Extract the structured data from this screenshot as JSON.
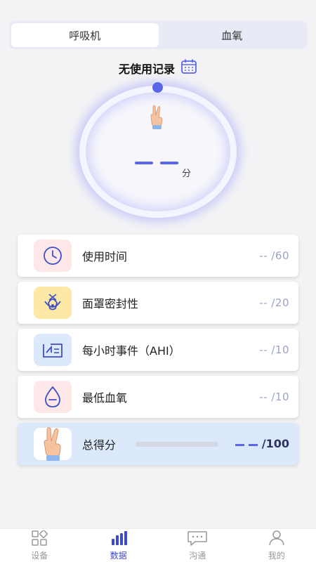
{
  "tabs": [
    {
      "label": "呼吸机",
      "active": true
    },
    {
      "label": "血氧",
      "active": false
    }
  ],
  "status": {
    "text": "无使用记录",
    "icon": "calendar-icon"
  },
  "score": {
    "unit": "分"
  },
  "metrics": [
    {
      "label": "使用时间",
      "value": "-- /60",
      "icon": "clock-icon",
      "icon_bg": "#fde7e8"
    },
    {
      "label": "面罩密封性",
      "value": "-- /20",
      "icon": "mask-icon",
      "icon_bg": "#fde9a6"
    },
    {
      "label": "每小时事件（AHI）",
      "value": "-- /10",
      "icon": "event-icon",
      "icon_bg": "#dce9fb"
    },
    {
      "label": "最低血氧",
      "value": "-- /10",
      "icon": "drop-icon",
      "icon_bg": "#fde7e8"
    }
  ],
  "total": {
    "label": "总得分",
    "max": "/100",
    "progress": 0
  },
  "nav": [
    {
      "label": "设备",
      "icon": "grid-icon",
      "active": false
    },
    {
      "label": "数据",
      "icon": "bar-chart-icon",
      "active": true
    },
    {
      "label": "沟通",
      "icon": "chat-icon",
      "active": false
    },
    {
      "label": "我的",
      "icon": "user-icon",
      "active": false
    }
  ],
  "colors": {
    "accent": "#5a67e8",
    "nav_active": "#3b49d8",
    "card_total_bg": "#dbe9fb"
  }
}
